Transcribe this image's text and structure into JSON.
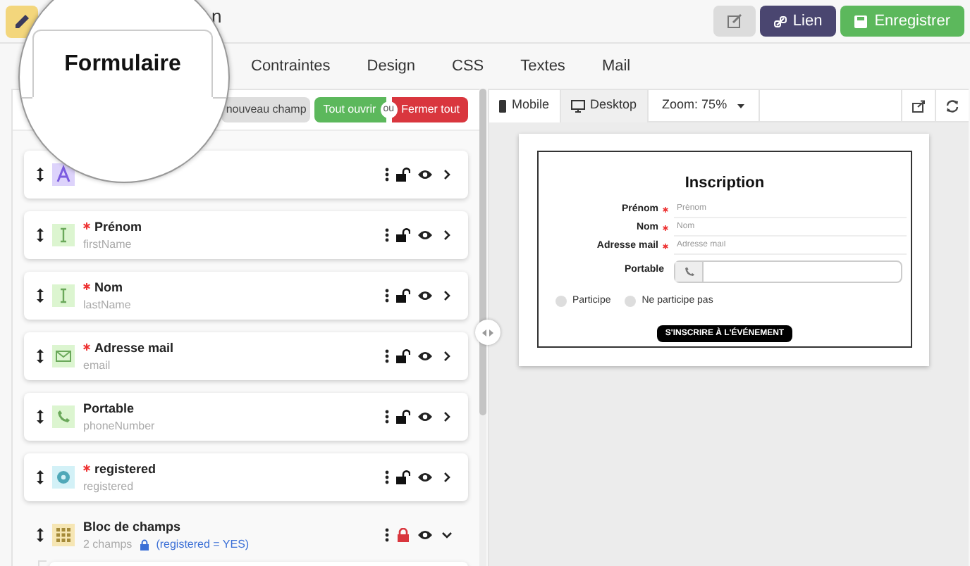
{
  "header": {
    "title": "n",
    "actions": [
      {
        "kind": "edit"
      },
      {
        "kind": "link",
        "label": "Lien"
      },
      {
        "kind": "save",
        "label": "Enregistrer"
      }
    ]
  },
  "magnifier": {
    "tab": "Formulaire"
  },
  "tabs": [
    {
      "label": "Contraintes",
      "selected": false
    },
    {
      "label": "Design",
      "selected": false
    },
    {
      "label": "CSS",
      "selected": false
    },
    {
      "label": "Textes",
      "selected": false
    },
    {
      "label": "Mail",
      "selected": false
    }
  ],
  "toolbar": {
    "new_field": "nouveau champ",
    "open_all": "Tout ouvrir",
    "separator": "ou",
    "close_all": "Fermer tout"
  },
  "fields": [
    {
      "kind": "heading",
      "locked": false,
      "expanded": false
    },
    {
      "kind": "text",
      "label": "Prénom",
      "name": "firstName",
      "required": true,
      "locked": false,
      "expanded": false
    },
    {
      "kind": "text",
      "label": "Nom",
      "name": "lastName",
      "required": true,
      "locked": false,
      "expanded": false
    },
    {
      "kind": "email",
      "label": "Adresse mail",
      "name": "email",
      "required": true,
      "locked": false,
      "expanded": false
    },
    {
      "kind": "phone",
      "label": "Portable",
      "name": "phoneNumber",
      "required": false,
      "locked": false,
      "expanded": false
    },
    {
      "kind": "radio",
      "label": "registered",
      "name": "registered",
      "required": true,
      "locked": false,
      "expanded": false
    },
    {
      "kind": "block",
      "label": "Bloc de champs",
      "count": "2 champs",
      "condition": "(registered = YES)",
      "required": false,
      "locked": true,
      "expanded": true
    }
  ],
  "preview_toolbar": {
    "modes": [
      {
        "kind": "mobile",
        "label": "Mobile",
        "selected": false
      },
      {
        "kind": "desktop",
        "label": "Desktop",
        "selected": true
      }
    ],
    "zoom": "Zoom: 75%"
  },
  "preview": {
    "title": "Inscription",
    "fields": [
      {
        "label": "Prénom",
        "placeholder": "Prénom",
        "required": true
      },
      {
        "label": "Nom",
        "placeholder": "Nom",
        "required": true
      },
      {
        "label": "Adresse mail",
        "placeholder": "Adresse mail",
        "required": true
      }
    ],
    "phone": {
      "label": "Portable"
    },
    "radios": [
      {
        "label": "Participe",
        "selected": false
      },
      {
        "label": "Ne participe pas",
        "selected": false
      }
    ],
    "submit": "S'INSCRIRE À L'ÉVÉNEMENT"
  }
}
